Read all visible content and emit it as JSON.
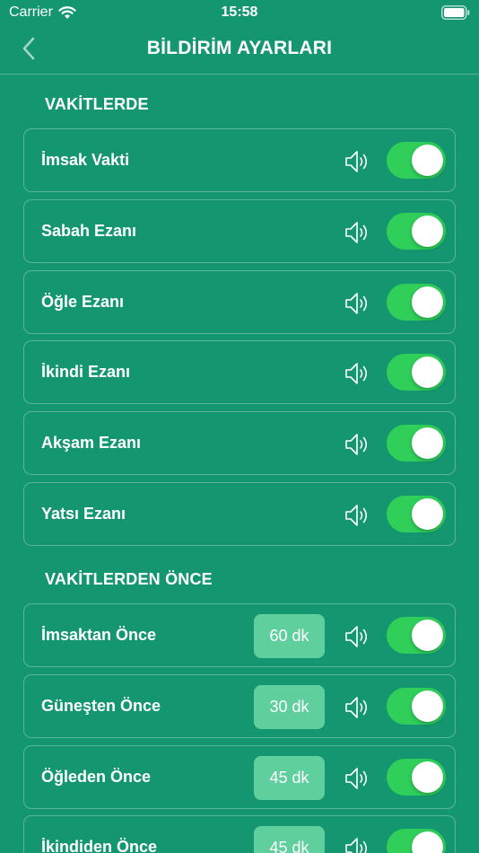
{
  "status": {
    "carrier": "Carrier",
    "time": "15:58"
  },
  "nav": {
    "title": "BİLDİRİM AYARLARI"
  },
  "sections": [
    {
      "title": "VAKİTLERDE"
    },
    {
      "title": "VAKİTLERDEN ÖNCE"
    }
  ],
  "times": [
    {
      "label": "İmsak Vakti",
      "enabled": true
    },
    {
      "label": "Sabah Ezanı",
      "enabled": true
    },
    {
      "label": "Öğle Ezanı",
      "enabled": true
    },
    {
      "label": "İkindi Ezanı",
      "enabled": true
    },
    {
      "label": "Akşam Ezanı",
      "enabled": true
    },
    {
      "label": "Yatsı Ezanı",
      "enabled": true
    }
  ],
  "before": [
    {
      "label": "İmsaktan Önce",
      "minutes": "60 dk",
      "enabled": true
    },
    {
      "label": "Güneşten Önce",
      "minutes": "30 dk",
      "enabled": true
    },
    {
      "label": "Öğleden Önce",
      "minutes": "45 dk",
      "enabled": true
    },
    {
      "label": "İkindiden Önce",
      "minutes": "45 dk",
      "enabled": true
    }
  ],
  "colors": {
    "background": "#149770",
    "toggle_on": "#2fcf5a",
    "minutes_chip": "#5ecf9d"
  },
  "icons": {
    "back": "chevron-left-icon",
    "sound": "speaker-icon",
    "wifi": "wifi-icon",
    "battery": "battery-icon"
  }
}
